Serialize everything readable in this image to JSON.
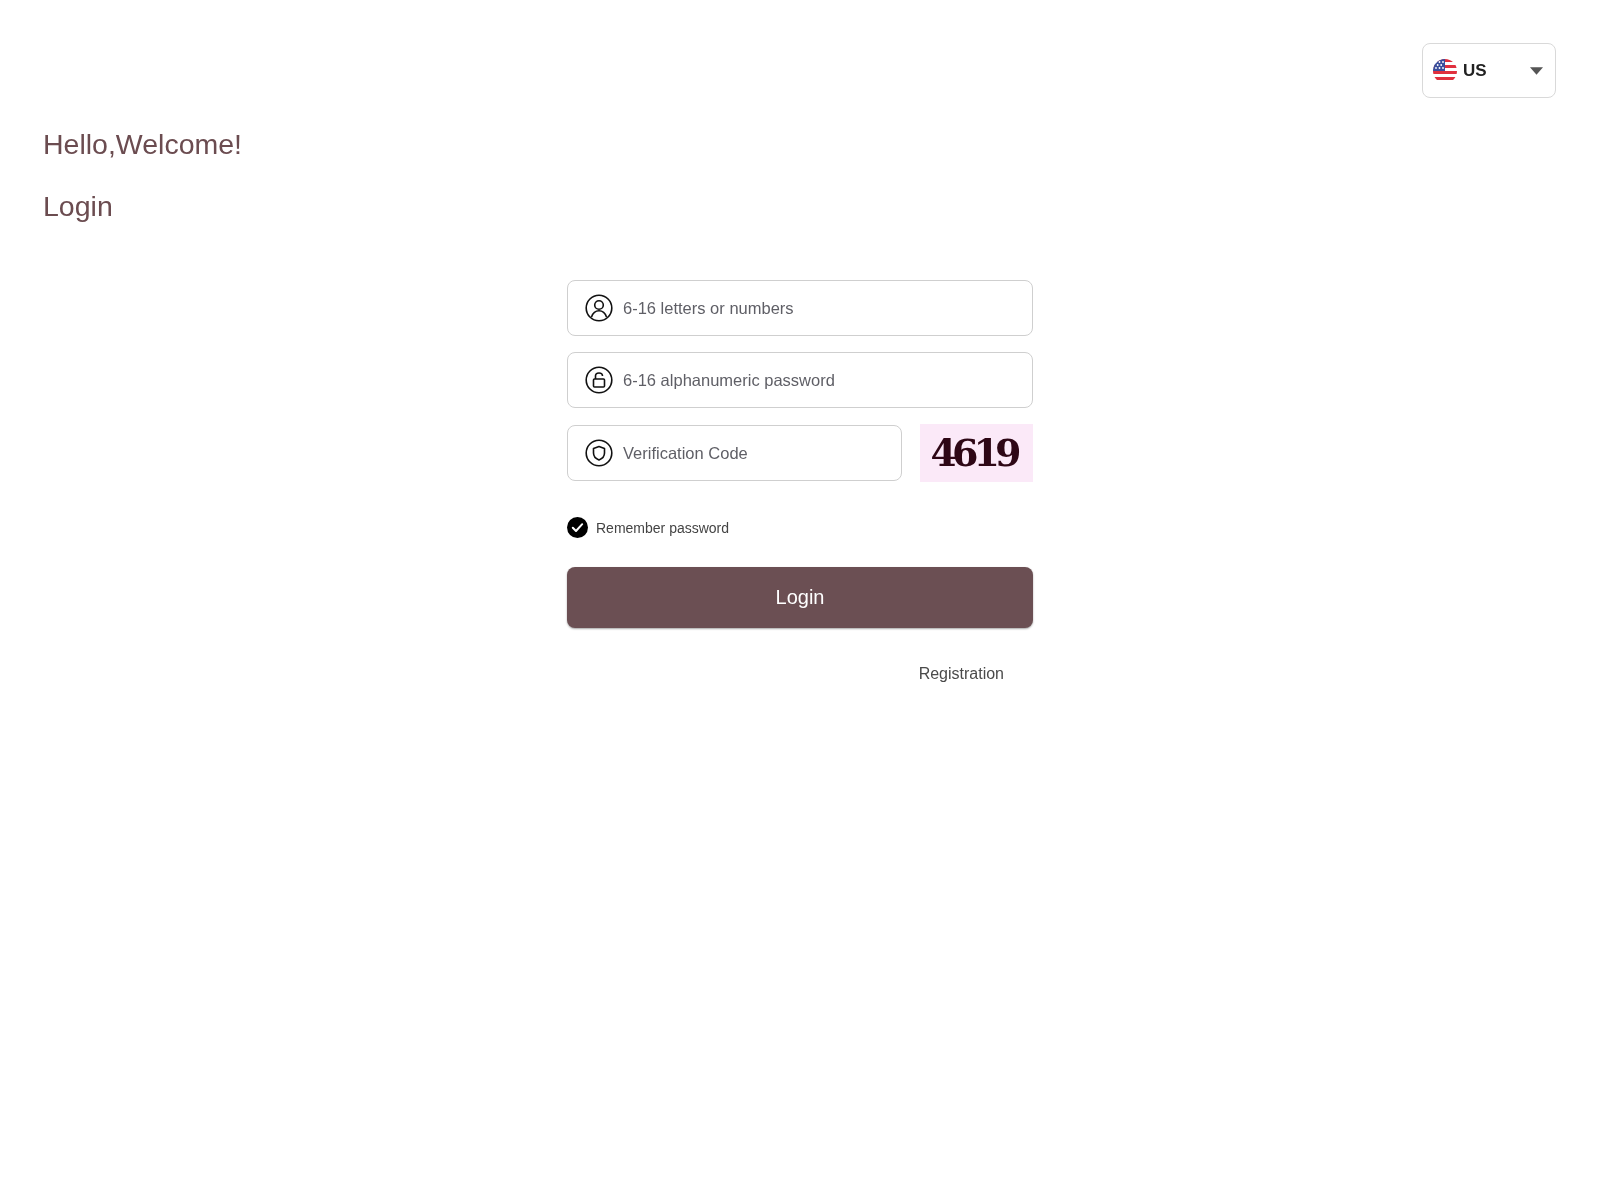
{
  "language_selector": {
    "label": "US"
  },
  "greeting": "Hello,Welcome!",
  "page_title": "Login",
  "fields": [
    {
      "kind": "username",
      "placeholder": "6-16 letters or numbers"
    },
    {
      "kind": "password",
      "placeholder": "6-16 alphanumeric password"
    },
    {
      "kind": "verification",
      "placeholder": "Verification Code"
    }
  ],
  "captcha": {
    "code": "4619"
  },
  "remember_password": {
    "label": "Remember password",
    "checked": true
  },
  "login_button": {
    "label": "Login"
  },
  "registration_link": {
    "label": "Registration"
  }
}
